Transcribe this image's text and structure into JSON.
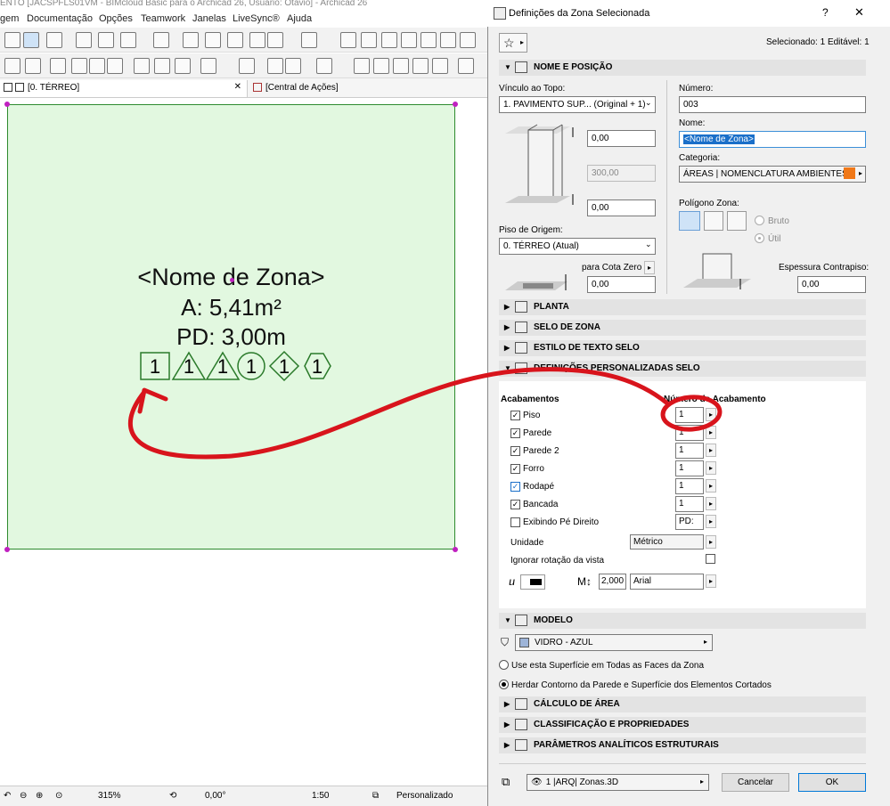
{
  "app": {
    "title_fragment": "ENTO [JACSPFLS01VM - BIMcloud Basic para o Archicad 26, Usuário: Otavio] - Archicad 26"
  },
  "menu": {
    "items": [
      "gem",
      "Documentação",
      "Opções",
      "Teamwork",
      "Janelas",
      "LiveSync®",
      "Ajuda"
    ]
  },
  "tabs": {
    "floor": "[0. TÉRREO]",
    "actions": "[Central de Ações]"
  },
  "zone_stamp": {
    "name": "<Nome de Zona>",
    "area": "A: 5,41m²",
    "height": "PD: 3,00m",
    "finish_symbols": [
      "1",
      "1",
      "1",
      "1",
      "1",
      "1"
    ]
  },
  "statusbar": {
    "zoom": "315%",
    "angle": "0,00°",
    "scale": "1:50",
    "mode": "Personalizado"
  },
  "dialog": {
    "title": "Definições da Zona Selecionada",
    "help": "?",
    "close": "✕",
    "selected": "Selecionado: 1 Editável: 1",
    "sections": {
      "name_position": "NOME E POSIÇÃO",
      "plan": "PLANTA",
      "zone_stamp": "SELO DE ZONA",
      "text_style": "ESTILO DE TEXTO SELO",
      "custom_settings": "DEFINIÇÕES PERSONALIZADAS SELO",
      "model": "MODELO",
      "area_calc": "CÁLCULO DE ÁREA",
      "classification": "CLASSIFICAÇÃO E PROPRIEDADES",
      "structural": "PARÂMETROS ANALÍTICOS ESTRUTURAIS"
    },
    "name_position": {
      "link_top_label": "Vínculo ao Topo:",
      "link_top_value": "1. PAVIMENTO SUP... (Original + 1)",
      "top_offset": "0,00",
      "height": "300,00",
      "bottom_offset": "0,00",
      "home_story_label": "Piso de Origem:",
      "home_story_value": "0. TÉRREO  (Atual)",
      "to_zero_label": "para Cota Zero",
      "to_zero_value": "0,00",
      "number_label": "Número:",
      "number_value": "003",
      "name_label": "Nome:",
      "name_value": "<Nome de Zona>",
      "category_label": "Categoria:",
      "category_value": "ÁREAS |  NOMENCLATURA AMBIENTES",
      "category_color": "#f07818",
      "polygon_label": "Polígono Zona:",
      "gross": "Bruto",
      "net": "Útil",
      "floor_thickness_label": "Espessura Contrapiso:",
      "floor_thickness_value": "0,00"
    },
    "custom": {
      "finishes_header": "Acabamentos",
      "finish_number_header": "Número de Acabamento",
      "rows": [
        {
          "label": "Piso",
          "value": "1"
        },
        {
          "label": "Parede",
          "value": "1"
        },
        {
          "label": "Parede 2",
          "value": "1"
        },
        {
          "label": "Forro",
          "value": "1"
        },
        {
          "label": "Rodapé",
          "value": "1"
        },
        {
          "label": "Bancada",
          "value": "1"
        }
      ],
      "show_height_label": "Exibindo Pé Direito",
      "show_height_value": "PD:",
      "unit_label": "Unidade",
      "unit_value": "Métrico",
      "ignore_rotation_label": "Ignorar rotação da vista",
      "text_size": "2,000",
      "font": "Arial"
    },
    "model": {
      "surface": "VIDRO - AZUL",
      "surface_color": "#9db4d8",
      "option_use": "Use esta Superfície em Todas as Faces da Zona",
      "option_inherit": "Herdar Contorno da Parede e  Superfície dos Elementos Cortados"
    },
    "footer": {
      "layer": "1 |ARQ| Zonas.3D",
      "cancel": "Cancelar",
      "ok": "OK"
    }
  },
  "annotation_color": "#d8141c"
}
